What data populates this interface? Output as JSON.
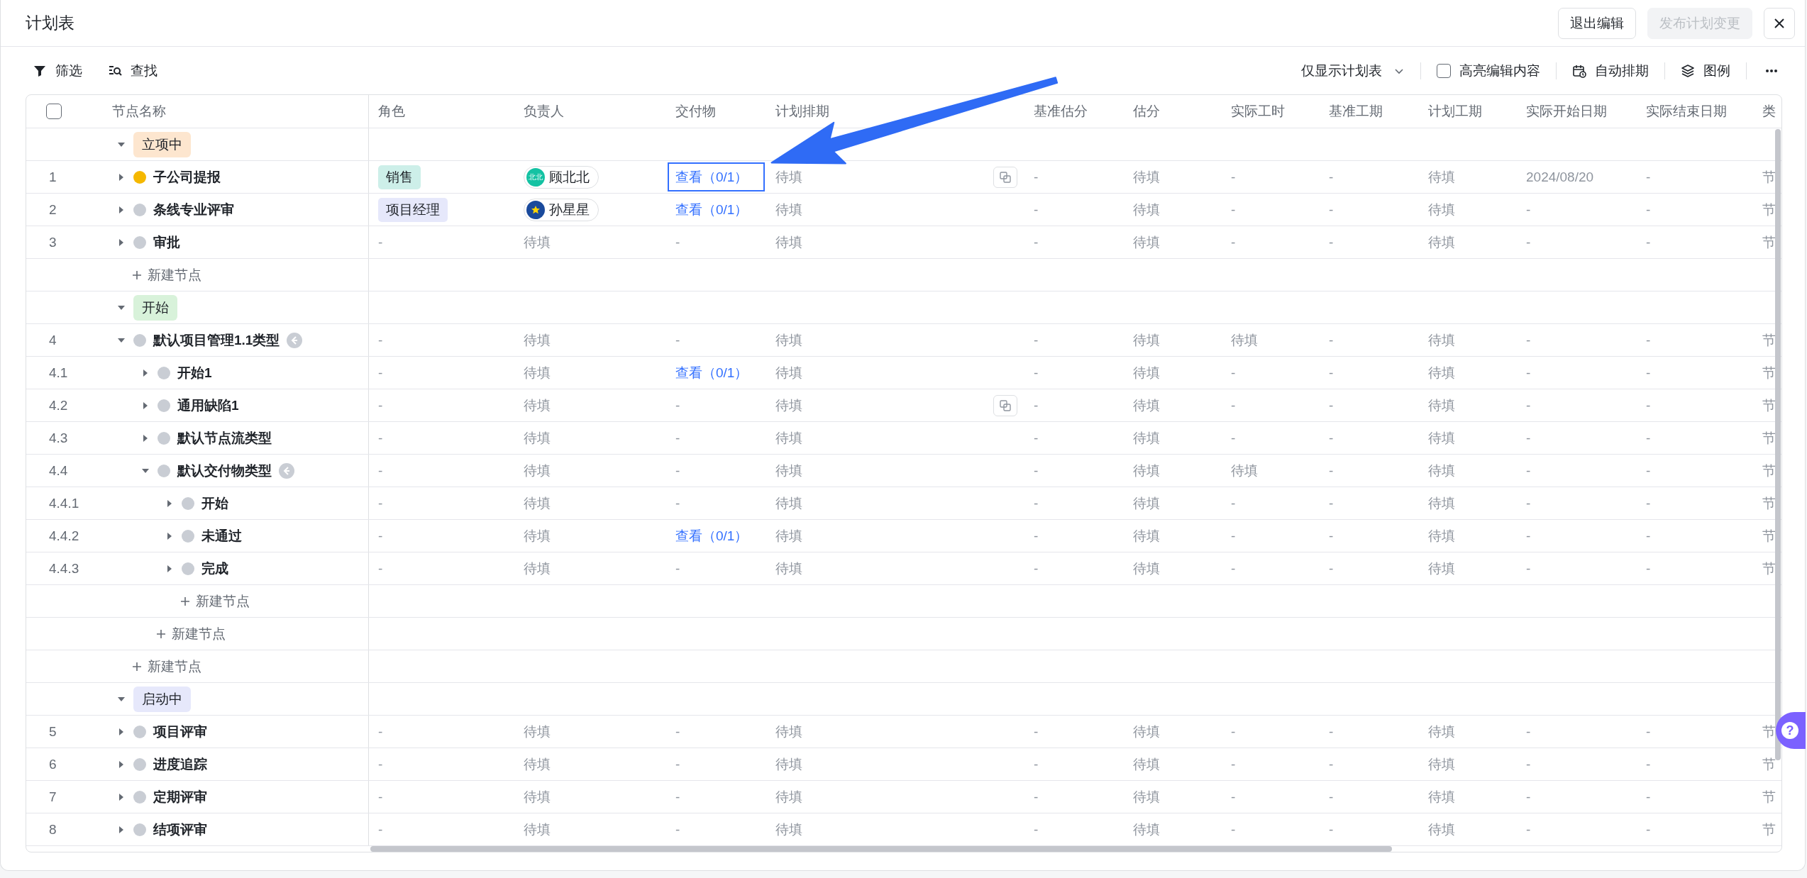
{
  "window": {
    "title": "计划表",
    "buttons": [
      {
        "label": "退出编辑",
        "disabled": false
      },
      {
        "label": "发布计划变更",
        "disabled": true
      }
    ]
  },
  "toolbar": {
    "left": [
      {
        "kind": "filter",
        "label": "筛选"
      },
      {
        "kind": "find",
        "label": "查找"
      }
    ],
    "view_select": {
      "value": "仅显示计划表"
    },
    "highlight": {
      "label": "高亮编辑内容",
      "checked": false
    },
    "right": [
      {
        "kind": "schedule",
        "label": "自动排期"
      },
      {
        "kind": "legend",
        "label": "图例"
      }
    ]
  },
  "table": {
    "select_all": {
      "checked": false
    },
    "columns": [
      "节点名称",
      "角色",
      "负责人",
      "交付物",
      "计划排期",
      "基准估分",
      "估分",
      "实际工时",
      "基准工期",
      "计划工期",
      "实际开始日期",
      "实际结束日期",
      "类"
    ],
    "groups": [
      {
        "label": "立项中",
        "color": "#fde6cf",
        "expanded": true,
        "rows": [
          {
            "kind": "node",
            "number": "1",
            "name": "子公司提报",
            "color": "#f5b800",
            "expanded": false,
            "linked": false,
            "copy_button": true,
            "role": {
              "text": "销售",
              "color": "#cdefe9"
            },
            "owner": {
              "name": "顾北北",
              "avatar": {
                "kind": "text",
                "text": "北北",
                "color": "#14c2a3"
              }
            },
            "deliverable": {
              "text": "查看（0/1）",
              "focused": true
            },
            "schedule": "待填",
            "cells": [
              "-",
              "待填",
              "-",
              "-",
              "待填",
              "2024/08/20",
              "-",
              "节"
            ]
          },
          {
            "kind": "node",
            "number": "2",
            "name": "条线专业评审",
            "color": "#c9cdd4",
            "expanded": false,
            "linked": false,
            "copy_button": false,
            "role": {
              "text": "项目经理",
              "color": "#e6e8fb"
            },
            "owner": {
              "name": "孙星星",
              "avatar": {
                "kind": "star",
                "color": "#1a4a9c"
              }
            },
            "deliverable": {
              "text": "查看（0/1）",
              "focused": false
            },
            "schedule": "待填",
            "cells": [
              "-",
              "待填",
              "-",
              "-",
              "待填",
              "-",
              "-",
              "节"
            ]
          },
          {
            "kind": "node",
            "number": "3",
            "name": "审批",
            "color": "#c9cdd4",
            "expanded": false,
            "linked": false,
            "copy_button": false,
            "role": "-",
            "owner": "待填",
            "deliverable": "-",
            "schedule": "待填",
            "cells": [
              "-",
              "待填",
              "-",
              "-",
              "待填",
              "-",
              "-",
              "节"
            ]
          },
          {
            "kind": "add",
            "label": "新建节点"
          }
        ]
      },
      {
        "label": "开始",
        "color": "#d8f2da",
        "expanded": true,
        "rows": [
          {
            "kind": "node",
            "number": "4",
            "name": "默认项目管理1.1类型",
            "color": "#c9cdd4",
            "expanded": true,
            "linked": true,
            "copy_button": false,
            "role": "-",
            "owner": "待填",
            "deliverable": "-",
            "schedule": "待填",
            "cells": [
              "-",
              "待填",
              "待填",
              "-",
              "待填",
              "-",
              "-",
              "节"
            ],
            "children": [
              {
                "kind": "node",
                "number": "4.1",
                "name": "开始1",
                "color": "#c9cdd4",
                "expanded": false,
                "linked": false,
                "copy_button": false,
                "role": "-",
                "owner": "待填",
                "deliverable": {
                  "text": "查看（0/1）",
                  "focused": false
                },
                "schedule": "待填",
                "cells": [
                  "-",
                  "待填",
                  "-",
                  "-",
                  "待填",
                  "-",
                  "-",
                  "节"
                ]
              },
              {
                "kind": "node",
                "number": "4.2",
                "name": "通用缺陷1",
                "color": "#c9cdd4",
                "expanded": false,
                "linked": false,
                "copy_button": true,
                "role": "-",
                "owner": "待填",
                "deliverable": "-",
                "schedule": "待填",
                "cells": [
                  "-",
                  "待填",
                  "-",
                  "-",
                  "待填",
                  "-",
                  "-",
                  "节"
                ]
              },
              {
                "kind": "node",
                "number": "4.3",
                "name": "默认节点流类型",
                "color": "#c9cdd4",
                "expanded": false,
                "linked": false,
                "copy_button": false,
                "role": "-",
                "owner": "待填",
                "deliverable": "-",
                "schedule": "待填",
                "cells": [
                  "-",
                  "待填",
                  "-",
                  "-",
                  "待填",
                  "-",
                  "-",
                  "节"
                ]
              },
              {
                "kind": "node",
                "number": "4.4",
                "name": "默认交付物类型",
                "color": "#c9cdd4",
                "expanded": true,
                "linked": true,
                "copy_button": false,
                "role": "-",
                "owner": "待填",
                "deliverable": "-",
                "schedule": "待填",
                "cells": [
                  "-",
                  "待填",
                  "待填",
                  "-",
                  "待填",
                  "-",
                  "-",
                  "节"
                ],
                "children": [
                  {
                    "kind": "node",
                    "number": "4.4.1",
                    "name": "开始",
                    "color": "#c9cdd4",
                    "expanded": false,
                    "linked": false,
                    "copy_button": false,
                    "role": "-",
                    "owner": "待填",
                    "deliverable": "-",
                    "schedule": "待填",
                    "cells": [
                      "-",
                      "待填",
                      "-",
                      "-",
                      "待填",
                      "-",
                      "-",
                      "节"
                    ]
                  },
                  {
                    "kind": "node",
                    "number": "4.4.2",
                    "name": "未通过",
                    "color": "#c9cdd4",
                    "expanded": false,
                    "linked": false,
                    "copy_button": false,
                    "role": "-",
                    "owner": "待填",
                    "deliverable": {
                      "text": "查看（0/1）",
                      "focused": false
                    },
                    "schedule": "待填",
                    "cells": [
                      "-",
                      "待填",
                      "-",
                      "-",
                      "待填",
                      "-",
                      "-",
                      "节"
                    ]
                  },
                  {
                    "kind": "node",
                    "number": "4.4.3",
                    "name": "完成",
                    "color": "#c9cdd4",
                    "expanded": false,
                    "linked": false,
                    "copy_button": false,
                    "role": "-",
                    "owner": "待填",
                    "deliverable": "-",
                    "schedule": "待填",
                    "cells": [
                      "-",
                      "待填",
                      "-",
                      "-",
                      "待填",
                      "-",
                      "-",
                      "节"
                    ]
                  },
                  {
                    "kind": "add",
                    "label": "新建节点"
                  }
                ]
              },
              {
                "kind": "add",
                "label": "新建节点"
              }
            ]
          },
          {
            "kind": "add",
            "label": "新建节点"
          }
        ]
      },
      {
        "label": "启动中",
        "color": "#e6e8fb",
        "expanded": true,
        "rows": [
          {
            "kind": "node",
            "number": "5",
            "name": "项目评审",
            "color": "#c9cdd4",
            "expanded": false,
            "linked": false,
            "copy_button": false,
            "role": "-",
            "owner": "待填",
            "deliverable": "-",
            "schedule": "待填",
            "cells": [
              "-",
              "待填",
              "-",
              "-",
              "待填",
              "-",
              "-",
              "节"
            ]
          },
          {
            "kind": "node",
            "number": "6",
            "name": "进度追踪",
            "color": "#c9cdd4",
            "expanded": false,
            "linked": false,
            "copy_button": false,
            "role": "-",
            "owner": "待填",
            "deliverable": "-",
            "schedule": "待填",
            "cells": [
              "-",
              "待填",
              "-",
              "-",
              "待填",
              "-",
              "-",
              "节"
            ]
          },
          {
            "kind": "node",
            "number": "7",
            "name": "定期评审",
            "color": "#c9cdd4",
            "expanded": false,
            "linked": false,
            "copy_button": false,
            "role": "-",
            "owner": "待填",
            "deliverable": "-",
            "schedule": "待填",
            "cells": [
              "-",
              "待填",
              "-",
              "-",
              "待填",
              "-",
              "-",
              "节"
            ]
          },
          {
            "kind": "node",
            "number": "8",
            "name": "结项评审",
            "color": "#c9cdd4",
            "expanded": false,
            "linked": false,
            "copy_button": false,
            "role": "-",
            "owner": "待填",
            "deliverable": "-",
            "schedule": "待填",
            "cells": [
              "-",
              "待填",
              "-",
              "-",
              "待填",
              "-",
              "-",
              "节"
            ]
          }
        ]
      }
    ]
  },
  "help_button": {
    "label": "?"
  }
}
